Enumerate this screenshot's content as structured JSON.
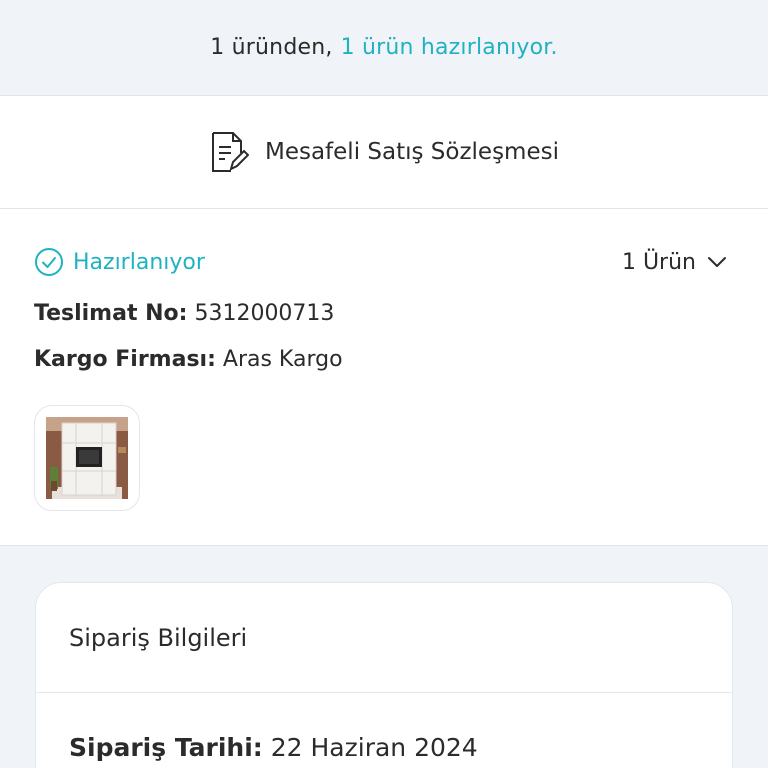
{
  "banner": {
    "prefix": "1 üründen,",
    "accent": "1 ürün hazırlanıyor."
  },
  "contract": {
    "label": "Mesafeli Satış Sözleşmesi",
    "icon": "document-edit-icon"
  },
  "delivery": {
    "status": "Hazırlanıyor",
    "item_count": "1 Ürün",
    "tracking_label": "Teslimat No:",
    "tracking_value": "5312000713",
    "carrier_label": "Kargo Firması:",
    "carrier_value": "Aras Kargo"
  },
  "order_info": {
    "title": "Sipariş Bilgileri",
    "date_label": "Sipariş Tarihi:",
    "date_value": "22 Haziran 2024"
  },
  "colors": {
    "accent": "#1fb3c2",
    "background": "#f0f3f7"
  }
}
